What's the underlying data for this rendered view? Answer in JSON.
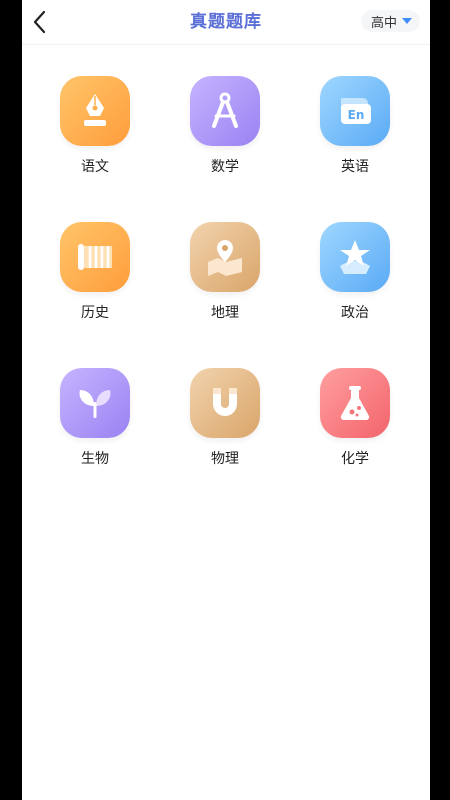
{
  "header": {
    "title": "真题题库",
    "level": "高中"
  },
  "subjects": [
    {
      "label": "语文",
      "icon": "fountain-pen-icon"
    },
    {
      "label": "数学",
      "icon": "compass-icon"
    },
    {
      "label": "英语",
      "icon": "en-chat-icon"
    },
    {
      "label": "历史",
      "icon": "scroll-icon"
    },
    {
      "label": "地理",
      "icon": "map-pin-icon"
    },
    {
      "label": "政治",
      "icon": "star-icon"
    },
    {
      "label": "生物",
      "icon": "sprout-icon"
    },
    {
      "label": "物理",
      "icon": "magnet-icon"
    },
    {
      "label": "化学",
      "icon": "flask-icon"
    }
  ],
  "colors": {
    "title": "#5b6fd6",
    "caret": "#3f8cff",
    "tile_orange": "#ffae4c",
    "tile_purple": "#a892f6",
    "tile_blue": "#6cb6f7",
    "tile_tan": "#e2b27c",
    "tile_red": "#f4757b"
  }
}
